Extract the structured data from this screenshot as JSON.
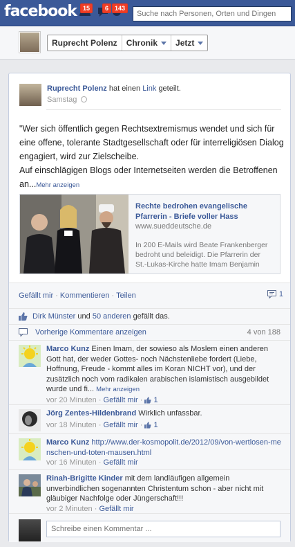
{
  "topbar": {
    "logo": "facebook",
    "friend_requests_count": "15",
    "messages_count": "6",
    "notifications_count": "143",
    "search_placeholder": "Suche nach Personen, Orten und Dingen"
  },
  "timeline_bar": {
    "name": "Ruprecht Polenz",
    "chronik": "Chronik",
    "jetzt": "Jetzt"
  },
  "post": {
    "author": "Ruprecht Polenz",
    "action_prefix": "hat einen",
    "action_link": "Link",
    "action_suffix": "geteilt.",
    "time": "Samstag",
    "text": "\"Wer sich öffentlich gegen Rechtsextremismus wendet und sich für eine offene, tolerante Stadtgesellschaft oder für interreligiösen Dialog engagiert, wird zur Zielscheibe.\nAuf einschlägigen Blogs oder Internetseiten werden die Betroffenen an...",
    "more": "Mehr anzeigen",
    "link_preview": {
      "title": "Rechte bedrohen evangelische Pfarrerin - Briefe voller Hass",
      "site": "www.sueddeutsche.de",
      "description": "In 200 E-Mails wird Beate Frankenberger bedroht und beleidigt. Die Pfarrerin der St.-Lukas-Kirche hatte Imam Benjamin"
    },
    "actions": {
      "like": "Gefällt mir",
      "comment": "Kommentieren",
      "share": "Teilen",
      "comment_count": "1"
    },
    "likes": {
      "person": "Dirk Münster",
      "and": "und",
      "others": "50 anderen",
      "suffix": "gefällt das."
    },
    "previous_comments": {
      "label": "Vorherige Kommentare anzeigen",
      "count": "4 von 188"
    },
    "comments": [
      {
        "author": "Marco Kunz",
        "text": "Einen Imam, der sowieso als Moslem einen anderen Gott hat, der weder Gottes- noch Nächstenliebe fordert (Liebe, Hoffnung, Freude - kommt alles im Koran NICHT vor), und der zusätzlich noch vom radikalen arabischen islamistisch ausgebildet wurde und fi...",
        "more": "Mehr anzeigen",
        "time": "vor 20 Minuten",
        "like": "Gefällt mir",
        "likes": "1"
      },
      {
        "author": "Jörg Zentes-Hildenbrand",
        "text": "Wirklich unfassbar.",
        "time": "vor 18 Minuten",
        "like": "Gefällt mir",
        "likes": "1"
      },
      {
        "author": "Marco Kunz",
        "text": "http://www.der-kosmopolit.de/2012/09/von-wertlosen-menschen-und-toten-mausen.html",
        "time": "vor 16 Minuten",
        "like": "Gefällt mir"
      },
      {
        "author": "Rinah-Brigitte Kinder",
        "text": "mit dem landläufigen allgemein unverbindlichen sogenannten Christentum schon - aber nicht mit gläubiger Nachfolge oder Jüngerschaft!!!",
        "time": "vor 2 Minuten",
        "like": "Gefällt mir"
      }
    ],
    "compose_placeholder": "Schreibe einen Kommentar ..."
  },
  "colors": {
    "brand_blue": "#3b5998",
    "badge_red": "#f03d25",
    "link_blue": "#3b5998"
  }
}
